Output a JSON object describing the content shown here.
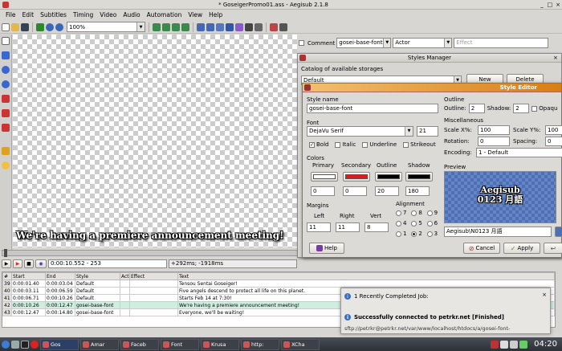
{
  "window": {
    "title": "* GoseigerPromo01.ass - Aegisub 2.1.8",
    "controls": [
      "_",
      "□",
      "×"
    ]
  },
  "menu": [
    "File",
    "Edit",
    "Subtitles",
    "Timing",
    "Video",
    "Audio",
    "Automation",
    "View",
    "Help"
  ],
  "toolbar": {
    "zoom": "100%"
  },
  "video": {
    "subtitle": "We're having a premiere announcement meeting!"
  },
  "edit": {
    "comment_label": "Comment",
    "style": "gosei-base-font",
    "actor": "Actor",
    "effect_placeholder": "Effect"
  },
  "styles_manager": {
    "title": "Styles Manager",
    "catalog_label": "Catalog of available storages",
    "catalog_value": "Default",
    "new_btn": "New",
    "delete_btn": "Delete"
  },
  "style_editor": {
    "title": "Style Editor",
    "name_label": "Style name",
    "name_value": "gosei-base-font",
    "font_label": "Font",
    "font_value": "DejaVu Serif",
    "font_size": "21",
    "bold": "Bold",
    "italic": "Italic",
    "underline": "Underline",
    "strikeout": "Strikeout",
    "colors_label": "Colors",
    "primary": "Primary",
    "secondary": "Secondary",
    "outline_c": "Outline",
    "shadow_c": "Shadow",
    "color_alpha": [
      "0",
      "0",
      "20",
      "180"
    ],
    "colors": {
      "primary": "#ffffff",
      "secondary": "#e8141e",
      "outline": "#000000",
      "shadow": "#000000"
    },
    "margins_label": "Margins",
    "left": "Left",
    "right": "Right",
    "vert": "Vert",
    "margin_values": [
      "11",
      "11",
      "8"
    ],
    "alignment_label": "Alignment",
    "alignment_selected": "2",
    "outline_label": "Outline",
    "outline_w": "Outline:",
    "outline_v": "2",
    "shadow_w": "Shadow:",
    "shadow_v": "2",
    "opaque": "Opaqu",
    "misc_label": "Miscellaneous",
    "scalex": "Scale X%:",
    "scalex_v": "100",
    "scaley": "Scale Y%:",
    "scaley_v": "100",
    "rotation": "Rotation:",
    "rotation_v": "0",
    "spacing": "Spacing:",
    "spacing_v": "0",
    "encoding": "Encoding:",
    "encoding_v": "1 - Default",
    "preview_label": "Preview",
    "preview_line1": "Aegisub",
    "preview_line2": "0123 月語",
    "preview_text": "Aegisub\\N0123 月語",
    "help": "Help",
    "cancel": "Cancel",
    "apply": "Apply"
  },
  "status": {
    "time": "0:00:10.552 - 253",
    "offset": "+292ms; -1918ms"
  },
  "grid": {
    "headers": [
      "#",
      "Start",
      "End",
      "Style",
      "Act",
      "Effect",
      "Text"
    ],
    "rows": [
      [
        "39",
        "0:00:01.40",
        "0:00:03.04",
        "Default",
        "",
        "",
        "Tensou Sentai Goseiger!"
      ],
      [
        "40",
        "0:00:03.11",
        "0:00:06.59",
        "Default",
        "",
        "",
        "Five angels descend to protect all life on this planet."
      ],
      [
        "41",
        "0:00:06.71",
        "0:00:10.26",
        "Default",
        "",
        "",
        "Starts Feb 14 at 7:30!"
      ],
      [
        "42",
        "0:00:10.26",
        "0:00:12.47",
        "gosei-base-font",
        "",
        "",
        "We're having a premiere announcement meeting!"
      ],
      [
        "43",
        "0:00:12.47",
        "0:00:14.80",
        "gosei-base-font",
        "",
        "",
        "Everyone, we'll be waiting!"
      ]
    ]
  },
  "notify": {
    "header": "1 Recently Completed Job:",
    "title": "Successfully connected to petrkr.net [Finished]",
    "detail": "sftp://petrkr@petrkr.net/var/www/localhost/htdocs/a/gosei-font-"
  },
  "taskbar": {
    "items": [
      "Gos",
      "Amar",
      "Faceb",
      "Font",
      "Krusa",
      "http:",
      "XCha"
    ],
    "clock": "04:20"
  }
}
